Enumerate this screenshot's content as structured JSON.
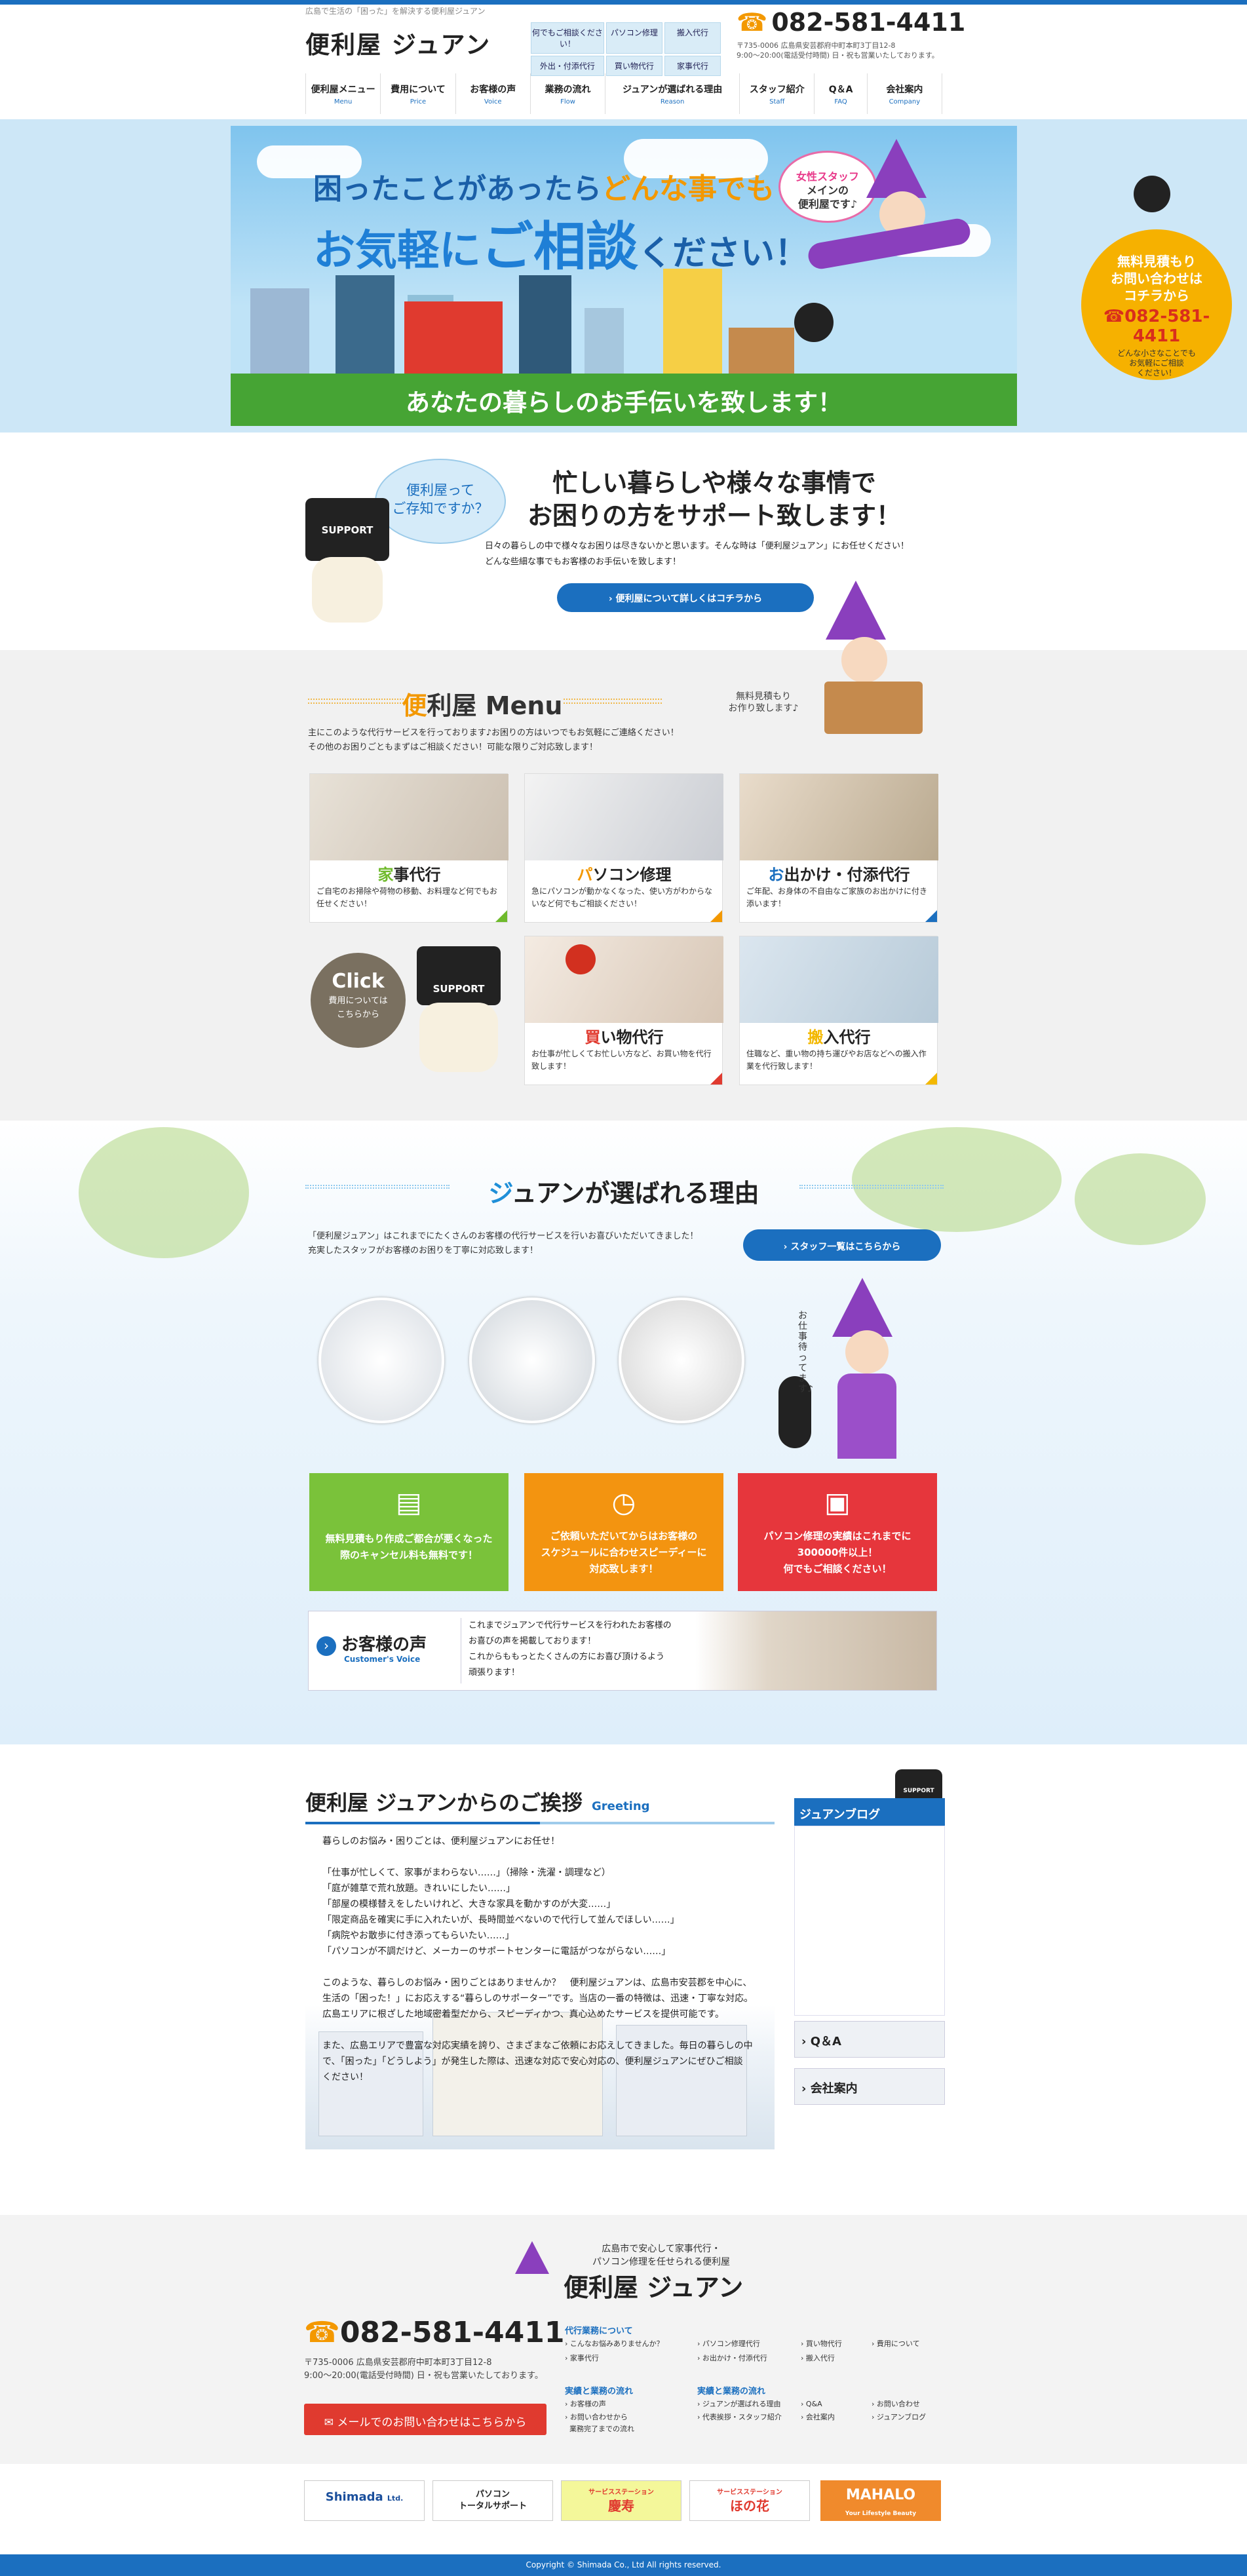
{
  "header": {
    "tagline": "広島で生活の「困った」を解決する便利屋ジュアン",
    "logo": "便利屋 ジュアン",
    "services": [
      "何でもご相談ください！",
      "パソコン修理",
      "搬入代行",
      "外出・付添代行",
      "買い物代行",
      "家事代行"
    ],
    "phone": "082-581-4411",
    "address": "〒735-0006 広島県安芸郡府中町本町3丁目12-8",
    "hours": "9:00〜20:00(電話受付時間) 日・祝も営業いたしております。"
  },
  "nav": [
    {
      "jp": "便利屋メニュー",
      "en": "Menu"
    },
    {
      "jp": "費用について",
      "en": "Price"
    },
    {
      "jp": "お客様の声",
      "en": "Voice"
    },
    {
      "jp": "業務の流れ",
      "en": "Flow"
    },
    {
      "jp": "ジュアンが選ばれる理由",
      "en": "Reason"
    },
    {
      "jp": "スタッフ紹介",
      "en": "Staff"
    },
    {
      "jp": "Q＆A",
      "en": "FAQ"
    },
    {
      "jp": "会社案内",
      "en": "Company"
    }
  ],
  "hero": {
    "line1a": "困ったことがあったら",
    "line1b": "どんな事でも",
    "line2a": "お気軽に",
    "line2b": "ご相談",
    "line2c": "ください！",
    "speech1": "女性スタッフ",
    "speech2": "メインの",
    "speech3": "便利屋です♪",
    "footer": "あなたの暮らしのお手伝いを致します！",
    "badge_line1": "無料見積もり",
    "badge_line2": "お問い合わせは",
    "badge_line3": "コチラから",
    "badge_phone": "082-581-4411",
    "badge_sub1": "どんな小さなことでも",
    "badge_sub2": "お気軽にご相談",
    "badge_sub3": "ください！"
  },
  "about": {
    "bubble1": "便利屋って",
    "bubble2": "ご存知ですか？",
    "robot": "SUPPORT",
    "title1": "忙しい暮らしや様々な事情で",
    "title2": "お困りの方をサポート致します！",
    "text1": "日々の暮らしの中で様々なお困りは尽きないかと思います。そんな時は「便利屋ジュアン」にお任せください！",
    "text2": "どんな些細な事でもお客様のお手伝いを致します！",
    "button": "便利屋について詳しくはコチラから"
  },
  "menu": {
    "title_a": "便",
    "title_b": "利屋  Menu",
    "intro1": "主にこのような代行サービスを行っております♪お困りの方はいつでもお気軽にご連絡ください！",
    "intro2": "その他のお困りごともまずはご相談ください！可能な限りご対応致します！",
    "witch_note1": "無料見積もり",
    "witch_note2": "お作り致します♪",
    "cards": [
      {
        "first": "家",
        "rest": "事代行",
        "desc": "ご自宅のお掃除や荷物の移動、お料理など何でもお任せください！",
        "color": "#6fba2c"
      },
      {
        "first": "パ",
        "rest": "ソコン修理",
        "desc": "急にパソコンが動かなくなった、使い方がわからないなど何でもご相談ください！",
        "color": "#f39800"
      },
      {
        "first": "お",
        "rest": "出かけ・付添代行",
        "desc": "ご年配、お身体の不自由なご家族のお出かけに付き添います！",
        "color": "#1b6fbf"
      },
      {
        "first": "買",
        "rest": "い物代行",
        "desc": "お仕事が忙しくてお忙しい方など、お買い物を代行致します！",
        "color": "#e03a2f"
      },
      {
        "first": "搬",
        "rest": "入代行",
        "desc": "住職など、重い物の持ち運びやお店などへの搬入作業を代行致します！",
        "color": "#f3b800"
      }
    ],
    "click_label": "Click",
    "click_sub1": "費用については",
    "click_sub2": "こちらから",
    "robot": "SUPPORT"
  },
  "reason": {
    "title_a": "ジ",
    "title_b": "ュアンが選ばれる理由",
    "text1": "「便利屋ジュアン」はこれまでにたくさんのお客様の代行サービスを行いお喜びいただいてきました！",
    "text2": "充実したスタッフがお客様のお困りを丁寧に対応致します！",
    "staff_button": "スタッフ一覧はこちらから",
    "witch_note": "お仕事待ってます♪",
    "boxes": [
      {
        "l1": "無料見積もり作成ご都合が悪くなった",
        "l2": "際のキャンセル料も無料です！",
        "color": "#7ac23a",
        "icon": "money-icon"
      },
      {
        "l1": "ご依頼いただいてからはお客様の",
        "l2": "スケジュールに合わせスピーディーに",
        "l3": "対応致します！",
        "color": "#f39410",
        "icon": "stopwatch-icon"
      },
      {
        "l1": "パソコン修理の実績はこれまでに",
        "l2": "300000件以上！",
        "l3": "何でもご相談ください！",
        "color": "#e6363c",
        "icon": "computer-icon"
      }
    ],
    "voice_title": "お客様の声",
    "voice_en": "Customer's Voice",
    "voice_text1": "これまでジュアンで代行サービスを行われたお客様の",
    "voice_text2": "お喜びの声を掲載しております！",
    "voice_text3": "これからももっとたくさんの方にお喜び頂けるよう",
    "voice_text4": "頑張ります！"
  },
  "greeting": {
    "title": "便利屋 ジュアンからのご挨拶",
    "en": "Greeting",
    "lines": [
      "暮らしのお悩み・困りごとは、便利屋ジュアンにお任せ！",
      "",
      "「仕事が忙しくて、家事がまわらない……」（掃除・洗濯・調理など）",
      "「庭が雑草で荒れ放題。きれいにしたい……」",
      "「部屋の模様替えをしたいけれど、大きな家具を動かすのが大変……」",
      "「限定商品を確実に手に入れたいが、長時間並べないので代行して並んでほしい……」",
      "「病院やお散歩に付き添ってもらいたい……」",
      "「パソコンが不調だけど、メーカーのサポートセンターに電話がつながらない……」",
      "",
      "このような、暮らしのお悩み・困りごとはありませんか？　便利屋ジュアンは、広島市安芸郡を中心に、",
      "生活の「困った！」にお応えする“暮らしのサポーター”です。当店の一番の特徴は、迅速・丁寧な対応。",
      "広島エリアに根ざした地域密着型だから、スピーディかつ、真心込めたサービスを提供可能です。",
      "",
      "また、広島エリアで豊富な対応実績を誇り、さまざまなご依頼にお応えしてきました。毎日の暮らしの中",
      "で、「困った」「どうしよう」が発生した際は、迅速な対応で安心対応の、便利屋ジュアンにぜひご相談",
      "ください！"
    ],
    "blog": "ジュアンブログ",
    "qa": "Q＆A",
    "company": "会社案内",
    "robot": "SUPPORT"
  },
  "footer": {
    "tag1": "広島市で安心して家事代行・",
    "tag2": "パソコン修理を任せられる便利屋",
    "logo": "便利屋 ジュアン",
    "phone": "082-581-4411",
    "address": "〒735-0006 広島県安芸郡府中町本町3丁目12-8",
    "hours": "9:00〜20:00(電話受付時間) 日・祝も営業いたしております。",
    "mail": "メールでのお問い合わせはこちらから",
    "col1_h": "代行業務について",
    "col1": [
      "こんなお悩みありませんか？",
      "家事代行",
      "パソコン修理代行",
      "お出かけ・付添代行",
      "買い物代行",
      "搬入代行",
      "費用について"
    ],
    "col2_h": "実績と業務の流れ",
    "col2": [
      "お客様の声",
      "お問い合わせから",
      "業務完了までの流れ"
    ],
    "col3_h": "実績と業務の流れ",
    "col3": [
      "ジュアンが選ばれる理由",
      "代表挨拶・スタッフ紹介",
      "Q&A",
      "会社案内",
      "お問い合わせ",
      "ジュアンブログ"
    ],
    "banners": [
      {
        "t": "Shimada",
        "s": "Ltd."
      },
      {
        "t": "パソコン",
        "s": "トータルサポート"
      },
      {
        "t": "サービスステーション",
        "s": "慶寿"
      },
      {
        "t": "サービスステーション",
        "s": "ほの花"
      },
      {
        "t": "MAHALO",
        "s": "Your Lifestyle Beauty"
      }
    ],
    "copyright": "Copyright © Shimada Co., Ltd All rights reserved."
  },
  "colors": {
    "accent": "#1b6fbf",
    "orange": "#f39800",
    "green": "#6fba2c",
    "red": "#e03a2f"
  }
}
